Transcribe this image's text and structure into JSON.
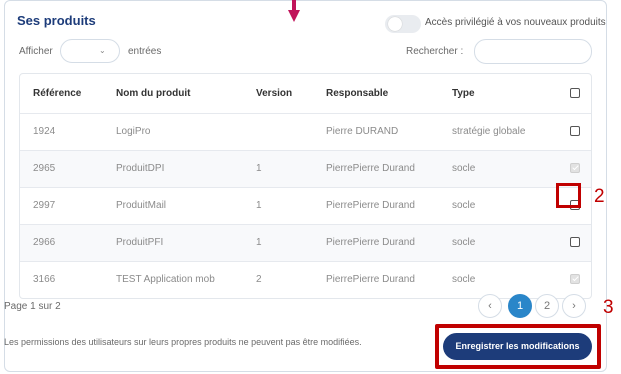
{
  "title": "Ses produits",
  "toggle": {
    "label": "Accès privilégié à vos nouveaux produits",
    "on": false
  },
  "length_control": {
    "prefix": "Afficher",
    "suffix": "entrées",
    "selected": ""
  },
  "search": {
    "label": "Rechercher :",
    "value": ""
  },
  "table": {
    "headers": [
      "Référence",
      "Nom du produit",
      "Version",
      "Responsable",
      "Type"
    ],
    "rows": [
      {
        "ref": "1924",
        "nom": "LogiPro",
        "version": "",
        "responsable": "Pierre DURAND",
        "type": "stratégie globale",
        "checkbox": "unchecked"
      },
      {
        "ref": "2965",
        "nom": "ProduitDPI",
        "version": "1",
        "responsable": "PierrePierre Durand",
        "type": "socle",
        "checkbox": "disabled-checked"
      },
      {
        "ref": "2997",
        "nom": "ProduitMail",
        "version": "1",
        "responsable": "PierrePierre Durand",
        "type": "socle",
        "checkbox": "unchecked"
      },
      {
        "ref": "2966",
        "nom": "ProduitPFI",
        "version": "1",
        "responsable": "PierrePierre Durand",
        "type": "socle",
        "checkbox": "unchecked"
      },
      {
        "ref": "3166",
        "nom": "TEST Application mob",
        "version": "2",
        "responsable": "PierrePierre Durand",
        "type": "socle",
        "checkbox": "disabled-checked"
      }
    ]
  },
  "pagination": {
    "info": "Page 1 sur 2",
    "prev": "‹",
    "pages": [
      "1",
      "2"
    ],
    "current": "1",
    "next": "›"
  },
  "note": "Les permissions des utilisateurs sur leurs propres produits ne peuvent pas être modifiées.",
  "save_button": "Enregistrer les modifications",
  "annotations": {
    "step_2": "2",
    "step_3": "3",
    "color": "#c00000"
  },
  "colors": {
    "accent": "#1d3c7a",
    "page_active": "#2a86c9"
  }
}
